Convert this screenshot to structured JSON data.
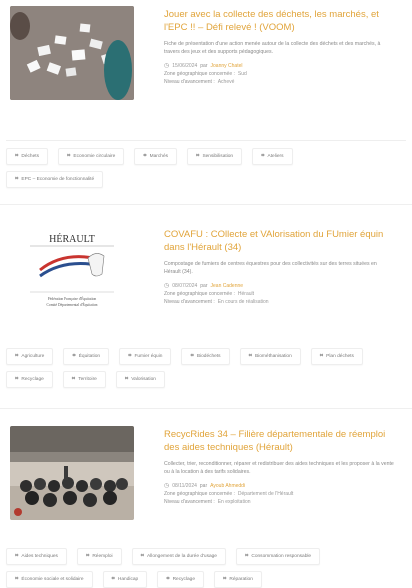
{
  "items": [
    {
      "title": "Jouer avec la collecte des déchets, les marchés, et l'EPC !! – Défi relevé ! (VOOM)",
      "description": "Fiche de présentation d'une action menée autour de la collecte des déchets et des marchés, à travers des jeux et des supports pédagogiques.",
      "date": "15/06/2024",
      "author": "Joanny Chatel",
      "zone_label": "Zone géographique concernée :",
      "zone_value": "Sud",
      "level_label": "Niveau d'avancement :",
      "level_value": "Achevé",
      "tags": [
        "Déchets",
        "Economie circulaire",
        "Marchés",
        "Sensibilisation",
        "Ateliers",
        "EPC – Economie de fonctionnalité"
      ]
    },
    {
      "title": "COVAFU : COllecte et VAlorisation du FUmier équin dans l'Hérault (34)",
      "description": "Compostage de fumiers de centres équestres pour des collectivités sur des terres situées en Hérault (34).",
      "date": "08/07/2024",
      "author": "Jean Cadenne",
      "zone_label": "Zone géographique concernée :",
      "zone_value": "Hérault",
      "level_label": "Niveau d'avancement :",
      "level_value": "En cours de réalisation",
      "logo_title": "HÉRAULT",
      "logo_lines": [
        "Fédération Française d'Équitation",
        "Comité Départemental d'Équitation"
      ],
      "tags": [
        "Agriculture",
        "Équitation",
        "Fumier équin",
        "Biodéchets",
        "Biométhanisation",
        "Plan déchets",
        "Recyclage",
        "Territoire",
        "Valorisation"
      ]
    },
    {
      "title": "RecycRides 34 – Filière départementale de réemploi des aides techniques (Hérault)",
      "description": "Collecter, trier, reconditionner, réparer et redistribuer des aides techniques et les proposer à la vente ou à la location à des tarifs solidaires.",
      "date": "08/11/2024",
      "author": "Ayoub Ahmeddi",
      "zone_label": "Zone géographique concernée :",
      "zone_value": "Département de l'Hérault",
      "level_label": "Niveau d'avancement :",
      "level_value": "En exploitation",
      "tags": [
        "Aides techniques",
        "Réemploi",
        "Allongement de la durée d'usage",
        "Consommation responsable",
        "Économie sociale et solidaire",
        "Handicap",
        "Recyclage",
        "Réparation"
      ]
    }
  ],
  "icons": {
    "clock": "clock-icon",
    "tag": "tag-icon"
  },
  "colors": {
    "accent": "#e1a43a",
    "text": "#8a8a8a"
  }
}
